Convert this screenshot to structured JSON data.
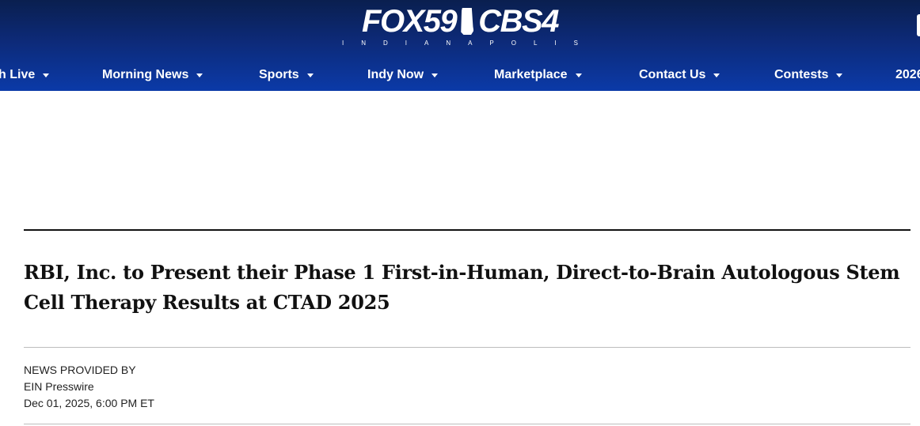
{
  "header": {
    "logo_main": "FOX59",
    "logo_second": "CBS4",
    "logo_sub": "INDIANAPOLIS",
    "colors": {
      "bg_top": "#0a1f4f",
      "bg_bottom": "#0b3aa8",
      "text": "#ffffff"
    }
  },
  "nav": {
    "items": [
      {
        "label": "h Live"
      },
      {
        "label": "Morning News"
      },
      {
        "label": "Sports"
      },
      {
        "label": "Indy Now"
      },
      {
        "label": "Marketplace"
      },
      {
        "label": "Contact Us"
      },
      {
        "label": "Contests"
      },
      {
        "label": "2026"
      }
    ]
  },
  "article": {
    "title": "RBI, Inc. to Present their Phase 1 First-in-Human, Direct-to-Brain Autologous Stem Cell Therapy Results at CTAD 2025",
    "provided_label": "NEWS PROVIDED BY",
    "provider": "EIN Presswire",
    "date": "Dec 01, 2025, 6:00 PM ET"
  }
}
